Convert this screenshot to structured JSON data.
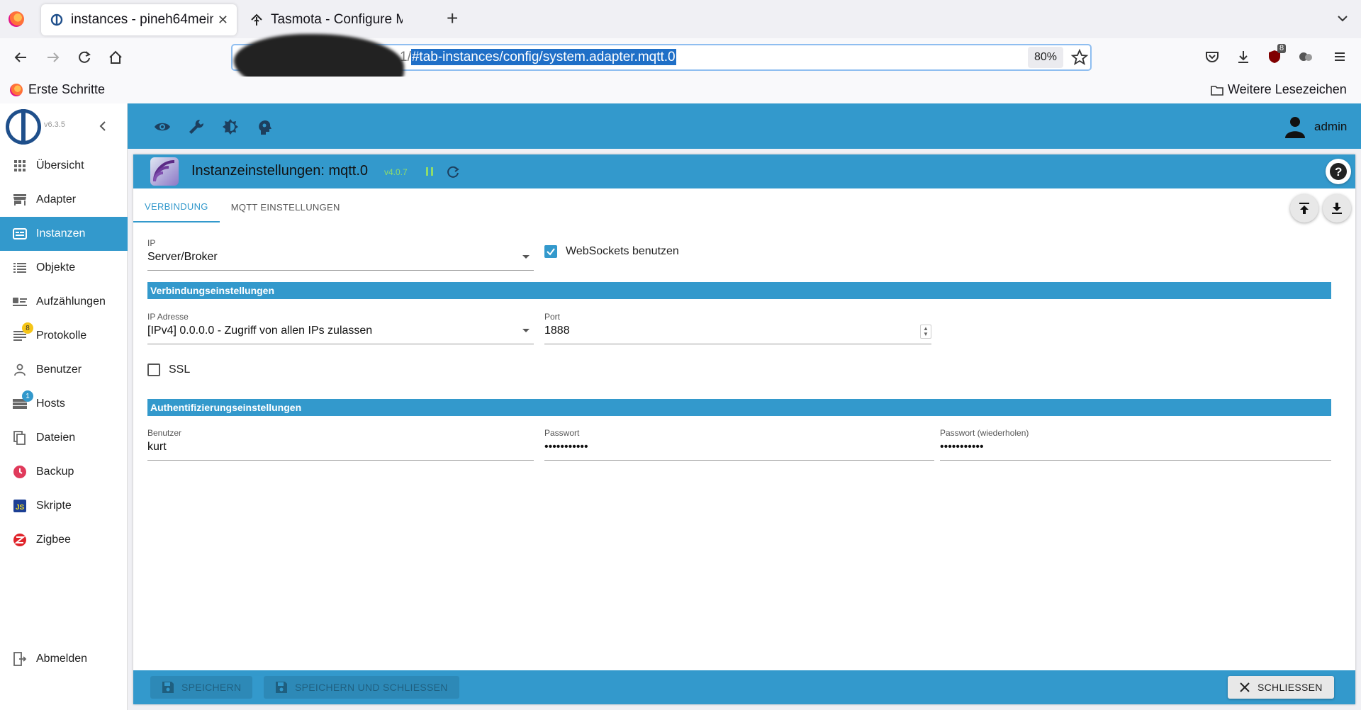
{
  "browser": {
    "tabs": [
      {
        "title": "instances - pineh64mein",
        "active": true
      },
      {
        "title": "Tasmota - Configure MQ",
        "active": false
      }
    ],
    "url": {
      "visible_prefix": "1/",
      "selected_text": "#tab-instances/config/system.adapter.mqtt.0"
    },
    "zoom": "80%",
    "extension_badge": "8",
    "bookmarks": {
      "left": "Erste Schritte",
      "right": "Weitere Lesezeichen"
    }
  },
  "app": {
    "version": "v6.3.5",
    "user": "admin",
    "menu": [
      {
        "label": "Übersicht",
        "icon": "grid-icon"
      },
      {
        "label": "Adapter",
        "icon": "store-icon"
      },
      {
        "label": "Instanzen",
        "icon": "instances-icon",
        "active": true
      },
      {
        "label": "Objekte",
        "icon": "list-icon"
      },
      {
        "label": "Aufzählungen",
        "icon": "enum-icon"
      },
      {
        "label": "Protokolle",
        "icon": "log-icon",
        "badge": "8"
      },
      {
        "label": "Benutzer",
        "icon": "user-icon"
      },
      {
        "label": "Hosts",
        "icon": "hosts-icon",
        "badge": "1"
      },
      {
        "label": "Dateien",
        "icon": "files-icon"
      },
      {
        "label": "Backup",
        "icon": "backup-icon"
      },
      {
        "label": "Skripte",
        "icon": "js-icon"
      },
      {
        "label": "Zigbee",
        "icon": "zigbee-icon"
      }
    ],
    "logout_label": "Abmelden"
  },
  "instance": {
    "title": "Instanzeinstellungen: mqtt.0",
    "version": "v4.0.7",
    "tabs": [
      "VERBINDUNG",
      "MQTT EINSTELLUNGEN"
    ],
    "ip_type": {
      "label": "IP",
      "value": "Server/Broker"
    },
    "websockets": {
      "label": "WebSockets benutzen",
      "checked": true
    },
    "section_connection": "Verbindungseinstellungen",
    "ip_address": {
      "label": "IP Adresse",
      "value": "[IPv4] 0.0.0.0 - Zugriff von allen IPs zulassen"
    },
    "port": {
      "label": "Port",
      "value": "1888"
    },
    "ssl": {
      "label": "SSL",
      "checked": false
    },
    "section_auth": "Authentifizierungseinstellungen",
    "user": {
      "label": "Benutzer",
      "value": "kurt"
    },
    "password": {
      "label": "Passwort",
      "value": "•••••••••••"
    },
    "password_repeat": {
      "label": "Passwort (wiederholen)",
      "value": "•••••••••••"
    },
    "footer": {
      "save": "SPEICHERN",
      "save_close": "SPEICHERN UND SCHLIESSEN",
      "close": "SCHLIESSEN"
    }
  },
  "colors": {
    "accent": "#3399cc",
    "version_green": "#8fdc6b"
  }
}
